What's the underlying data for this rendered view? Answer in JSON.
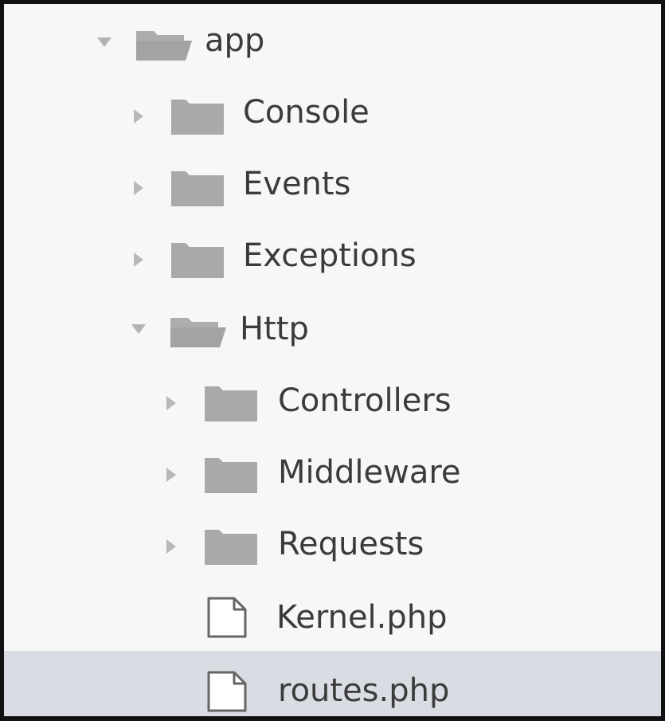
{
  "tree": {
    "items": [
      {
        "label": "app",
        "kind": "folder",
        "state": "expanded"
      },
      {
        "label": "Console",
        "kind": "folder",
        "state": "collapsed"
      },
      {
        "label": "Events",
        "kind": "folder",
        "state": "collapsed"
      },
      {
        "label": "Exceptions",
        "kind": "folder",
        "state": "collapsed"
      },
      {
        "label": "Http",
        "kind": "folder",
        "state": "expanded"
      },
      {
        "label": "Controllers",
        "kind": "folder",
        "state": "collapsed"
      },
      {
        "label": "Middleware",
        "kind": "folder",
        "state": "collapsed"
      },
      {
        "label": "Requests",
        "kind": "folder",
        "state": "collapsed"
      },
      {
        "label": "Kernel.php",
        "kind": "file"
      },
      {
        "label": "routes.php",
        "kind": "file",
        "selected": true
      }
    ]
  },
  "colors": {
    "background": "#f7f7f7",
    "selected_row": "#d9dce2",
    "text": "#3b3b3b",
    "folder_icon": "#a9a9a9",
    "chevron": "#b8b8b8",
    "frame_border": "#111111"
  }
}
